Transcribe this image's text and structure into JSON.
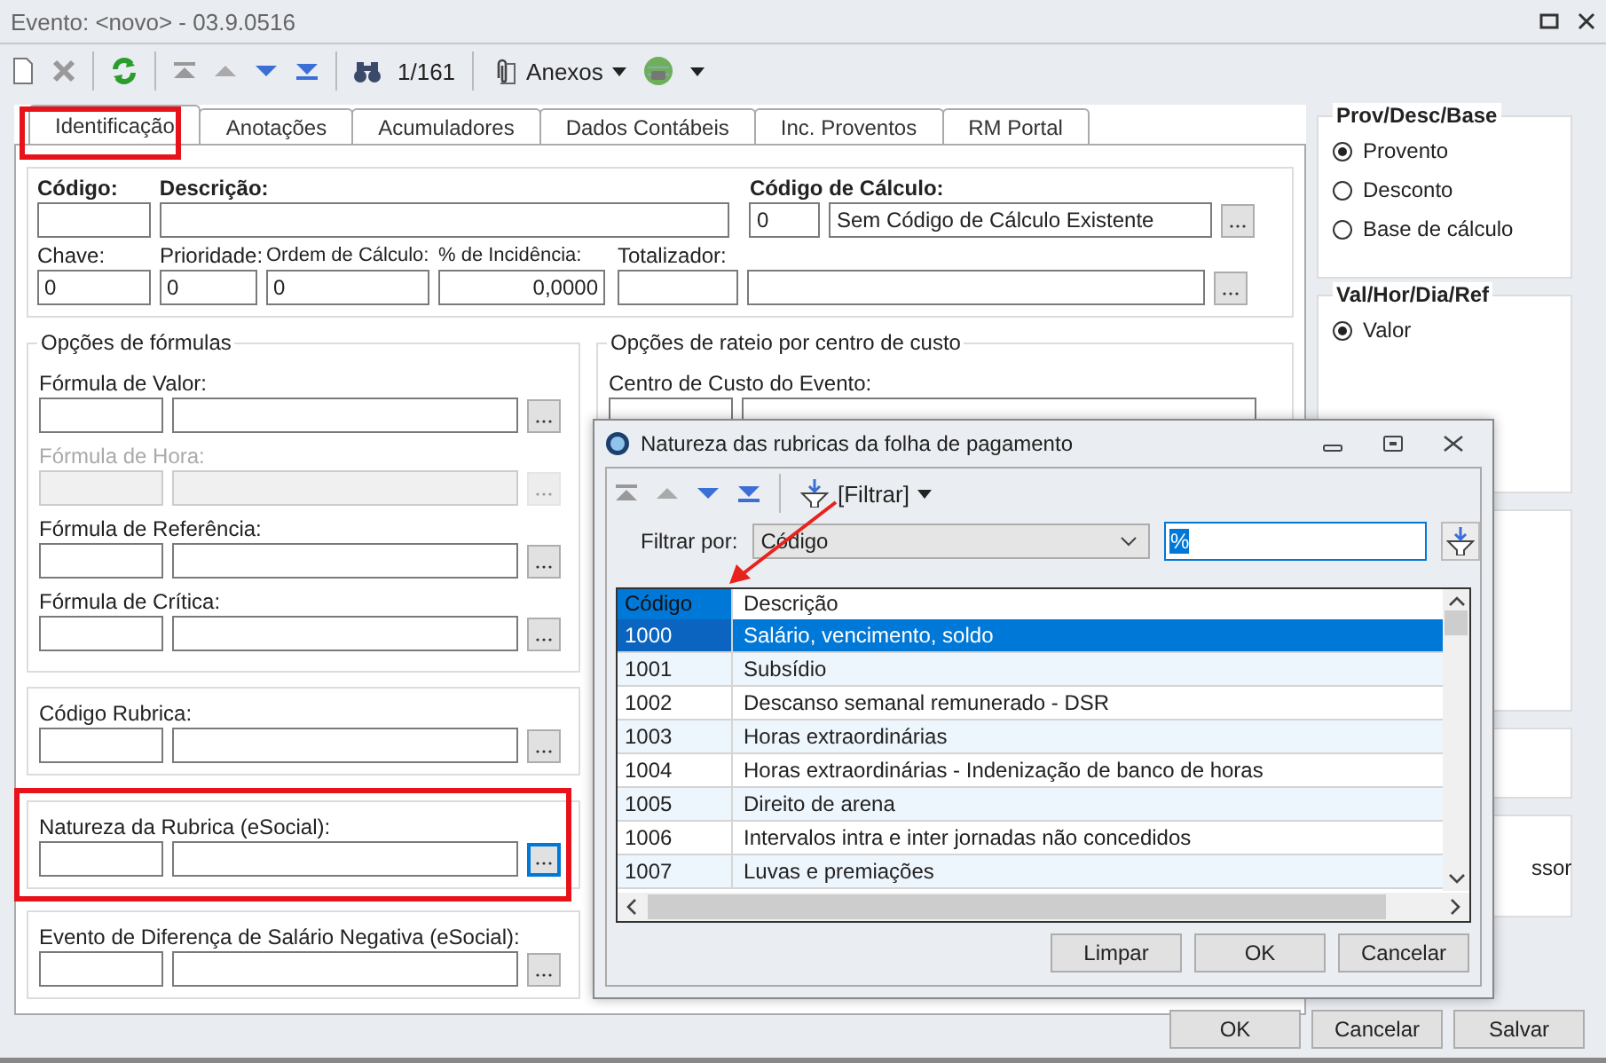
{
  "window": {
    "title": "Evento: <novo> - 03.9.0516"
  },
  "toolbar": {
    "counter": "1/161",
    "attachments": "Anexos"
  },
  "tabs": [
    {
      "label": "Identificação",
      "selected": true
    },
    {
      "label": "Anotações",
      "selected": false
    },
    {
      "label": "Acumuladores",
      "selected": false
    },
    {
      "label": "Dados Contábeis",
      "selected": false
    },
    {
      "label": "Inc. Proventos",
      "selected": false
    },
    {
      "label": "RM Portal",
      "selected": false
    }
  ],
  "basic": {
    "codigo_label": "Código:",
    "descricao_label": "Descrição:",
    "calc_label": "Código de Cálculo:",
    "calc_code": "0",
    "calc_description": "Sem Código de Cálculo Existente",
    "chave_label": "Chave:",
    "chave": "0",
    "prioridade_label": "Prioridade:",
    "prioridade": "0",
    "ordem_label": "Ordem de Cálculo:",
    "ordem": "0",
    "incidencia_label": "% de Incidência:",
    "incidencia": "0,0000",
    "totalizador_label": "Totalizador:"
  },
  "formula_options": {
    "title": "Opções de fórmulas",
    "fields": [
      {
        "label": "Fórmula de Valor:",
        "disabled": false
      },
      {
        "label": "Fórmula de Hora:",
        "disabled": true
      },
      {
        "label": "Fórmula de Referência:",
        "disabled": false
      },
      {
        "label": "Fórmula de Crítica:",
        "disabled": false
      }
    ]
  },
  "lookups": [
    {
      "label": "Código Rubrica:",
      "focused": false
    },
    {
      "label": "Natureza da Rubrica (eSocial):",
      "focused": true
    },
    {
      "label": "Evento de Diferença de Salário Negativa (eSocial):",
      "focused": false
    }
  ],
  "cost_center": {
    "title": "Opções de rateio por centro de custo",
    "field_label": "Centro de Custo do Evento:"
  },
  "prov_desc_base": {
    "title": "Prov/Desc/Base",
    "options": [
      {
        "label": "Provento",
        "selected": true
      },
      {
        "label": "Desconto",
        "selected": false
      },
      {
        "label": "Base de cálculo",
        "selected": false
      }
    ]
  },
  "val_hor": {
    "title": "Val/Hor/Dia/Ref",
    "options": [
      {
        "label": "Valor",
        "selected": true
      }
    ]
  },
  "side_fragment": "ssor",
  "dialog": {
    "title": "Natureza das rubricas da folha de pagamento",
    "filter_button": "[Filtrar]",
    "filter_label": "Filtrar por:",
    "filter_field": "Código",
    "filter_value": "%",
    "columns": [
      "Código",
      "Descrição"
    ],
    "rows": [
      {
        "code": "1000",
        "description": "Salário, vencimento, soldo",
        "selected": true
      },
      {
        "code": "1001",
        "description": "Subsídio",
        "selected": false
      },
      {
        "code": "1002",
        "description": "Descanso semanal remunerado - DSR",
        "selected": false
      },
      {
        "code": "1003",
        "description": "Horas extraordinárias",
        "selected": false
      },
      {
        "code": "1004",
        "description": "Horas extraordinárias - Indenização de banco de horas",
        "selected": false
      },
      {
        "code": "1005",
        "description": "Direito de arena",
        "selected": false
      },
      {
        "code": "1006",
        "description": "Intervalos intra e inter jornadas não concedidos",
        "selected": false
      },
      {
        "code": "1007",
        "description": "Luvas e premiações",
        "selected": false
      }
    ],
    "buttons": [
      "Limpar",
      "OK",
      "Cancelar"
    ]
  },
  "buttons": [
    "OK",
    "Cancelar",
    "Salvar"
  ]
}
